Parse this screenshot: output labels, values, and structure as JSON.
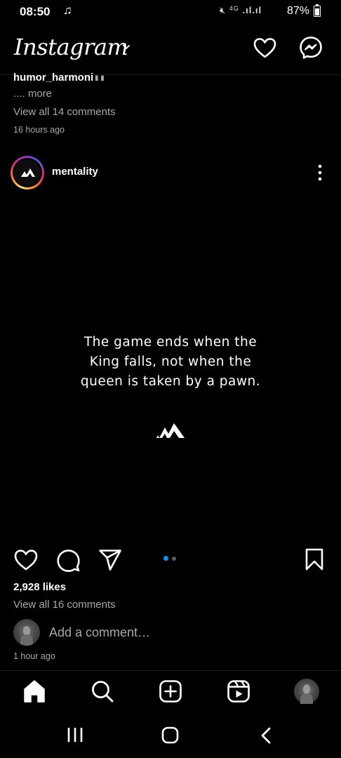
{
  "status_bar": {
    "time": "08:50",
    "music_icon": "music-note-icon",
    "signal_text": "4G",
    "battery_text": "87%",
    "battery_level": 0.87
  },
  "header": {
    "brand": "Instagram",
    "icons": [
      "chevron-down-icon",
      "heart-icon",
      "messenger-icon"
    ]
  },
  "previous_post": {
    "username": "humor_harmoni",
    "more": ".... more",
    "view_comments": "View all 14 comments",
    "time_ago": "16 hours ago"
  },
  "post": {
    "username": "mentality",
    "quote_lines": [
      "The game ends when the",
      "King falls, not when the",
      "queen is taken by a pawn."
    ],
    "carousel_dots": 2,
    "carousel_active_index": 0,
    "likes": "2,928 likes",
    "view_comments": "View all 16 comments",
    "add_comment_placeholder": "Add a comment…",
    "time_ago": "1 hour ago"
  },
  "bottom_nav": {
    "items": [
      "home-icon",
      "search-icon",
      "create-icon",
      "reels-icon",
      "profile-avatar"
    ]
  },
  "system_nav": {
    "items": [
      "recent-apps-icon",
      "home-circle-icon",
      "back-icon"
    ]
  },
  "colors": {
    "background": "#000000",
    "secondary_text": "#a8a8a8",
    "accent_blue": "#0095f6"
  }
}
